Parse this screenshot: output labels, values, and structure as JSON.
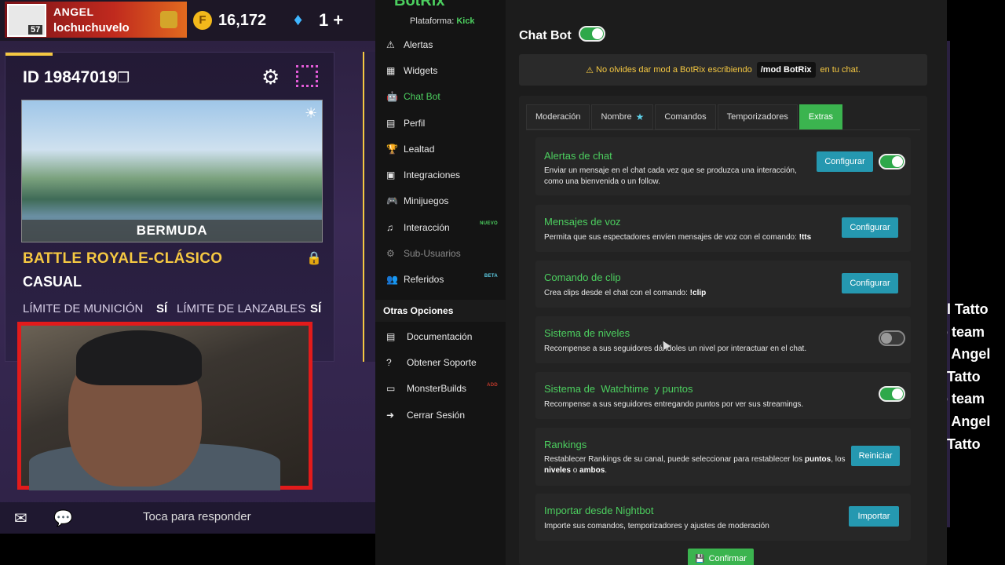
{
  "game": {
    "player_tag": "ANGEL",
    "player_name": "lochuchuvelo",
    "avatar_level": "57",
    "coins": "16,172",
    "diamonds": "1 +",
    "room_id": "ID 19847019",
    "map_name": "BERMUDA",
    "mode_title": "BATTLE ROYALE-CLÁSICO",
    "mode_sub": "CASUAL",
    "rule1_label": "LÍMITE DE MUNICIÓN",
    "rule1_value": "SÍ",
    "rule2_label": "LÍMITE DE LANZABLES",
    "rule2_value": "SÍ",
    "reply_hint": "Toca para responder",
    "icons": [
      "copy-icon",
      "gear-icon",
      "qr-icon",
      "sun-icon",
      "lock-icon",
      "dm-icon",
      "chat-icon",
      "coin-icon",
      "diamond-icon"
    ]
  },
  "sidebar": {
    "brand": "BotRix",
    "platform_label": "Plataforma:",
    "platform_value": "Kick",
    "items": [
      {
        "label": "Alertas",
        "icon": "⚠"
      },
      {
        "label": "Widgets",
        "icon": "▦"
      },
      {
        "label": "Chat Bot",
        "icon": "🤖"
      },
      {
        "label": "Perfil",
        "icon": "▤"
      },
      {
        "label": "Lealtad",
        "icon": "🏆"
      },
      {
        "label": "Integraciones",
        "icon": "▣"
      },
      {
        "label": "Minijuegos",
        "icon": "🎮"
      },
      {
        "label": "Interacción",
        "icon": "♫",
        "badge": "NUEVO"
      },
      {
        "label": "Sub-Usuarios",
        "icon": "⚙"
      },
      {
        "label": "Referidos",
        "icon": "👥",
        "badge": "BETA"
      }
    ],
    "section_title": "Otras Opciones",
    "other_items": [
      {
        "label": "Documentación",
        "icon": "▤"
      },
      {
        "label": "Obtener Soporte",
        "icon": "?"
      },
      {
        "label": "MonsterBuilds",
        "icon": "▭",
        "badge": "ADD"
      },
      {
        "label": "Cerrar Sesión",
        "icon": "➜"
      }
    ]
  },
  "main": {
    "title": "Chat Bot",
    "notice": {
      "text_before": "No olvides dar mod a BotRix escribiendo",
      "command": "/mod BotRix",
      "text_after": "en tu chat."
    },
    "tabs": [
      "Moderación",
      "Nombre",
      "Comandos",
      "Temporizadores",
      "Extras"
    ],
    "active_tab": "Extras",
    "features": [
      {
        "title": "Alertas de chat",
        "desc": "Enviar un mensaje en el chat cada vez que se produzca una interacción, como una bienvenida o un follow.",
        "button": "Configurar",
        "toggle": "on"
      },
      {
        "title": "Mensajes de voz",
        "desc": "Permita que sus espectadores envíen mensajes de voz con el comando:",
        "desc_bold": "!tts",
        "button": "Configurar"
      },
      {
        "title": "Comando de clip",
        "desc": "Crea clips desde el chat con el comando:",
        "desc_bold": "!clip",
        "button": "Configurar"
      },
      {
        "title": "Sistema de niveles",
        "desc": "Recompense a sus seguidores dándoles un nivel por interactuar en el chat.",
        "toggle": "off"
      },
      {
        "title": "Sistema de  Watchtime  y puntos",
        "desc": "Recompense a sus seguidores entregando puntos por ver sus streamings.",
        "toggle": "on"
      },
      {
        "title": "Rankings",
        "desc_p1": "Restablecer Rankings de su canal, puede seleccionar para restablecer los",
        "desc_b1": "puntos",
        "desc_p2": ",",
        "desc_b2": "los",
        "desc_b3": "niveles",
        "desc_p3": "o",
        "desc_b4": "ambos",
        "desc_p4": ".",
        "button": "Reiniciar"
      },
      {
        "title": "Importar desde Nightbot",
        "desc": "Importe sus comandos, temporizadores y ajustes de moderación",
        "button": "Importar"
      }
    ],
    "confirm_label": "Confirmar"
  },
  "overlay_chat": [
    "el Tatto",
    "o team",
    "n Angel",
    "l Tatto",
    "o team",
    "n Angel",
    "l Tatto"
  ],
  "colors": {
    "accent": "#4ccf5f",
    "button": "#2598b0",
    "active_tab": "#3bb44f",
    "notice": "#f5c842"
  }
}
